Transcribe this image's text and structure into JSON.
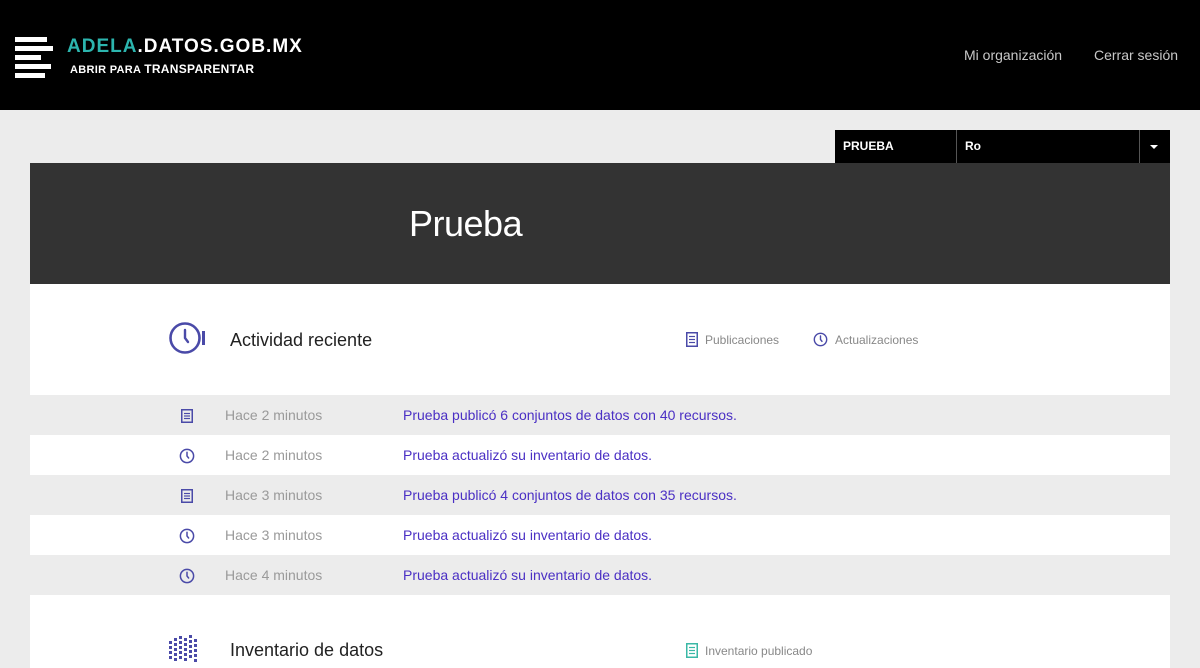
{
  "header": {
    "logo_accent": "ADELA",
    "logo_rest": ".DATOS.GOB.MX",
    "tagline_a": "ABRIR PARA",
    "tagline_b": "TRANSPARENTAR",
    "nav": [
      {
        "label": "Mi organización"
      },
      {
        "label": "Cerrar sesión"
      }
    ]
  },
  "org_selector": {
    "label": "PRUEBA",
    "value": "Ro"
  },
  "hero": {
    "title": "Prueba"
  },
  "activity": {
    "title": "Actividad reciente",
    "filters": [
      {
        "label": "Publicaciones",
        "icon": "document-icon"
      },
      {
        "label": "Actualizaciones",
        "icon": "clock-icon"
      }
    ],
    "rows": [
      {
        "icon": "document-icon",
        "time": "Hace 2 minutos",
        "message": "Prueba publicó 6 conjuntos de datos con 40 recursos."
      },
      {
        "icon": "clock-icon",
        "time": "Hace 2 minutos",
        "message": "Prueba actualizó su inventario de datos."
      },
      {
        "icon": "document-icon",
        "time": "Hace 3 minutos",
        "message": "Prueba publicó 4 conjuntos de datos con 35 recursos."
      },
      {
        "icon": "clock-icon",
        "time": "Hace 3 minutos",
        "message": "Prueba actualizó su inventario de datos."
      },
      {
        "icon": "clock-icon",
        "time": "Hace 4 minutos",
        "message": "Prueba actualizó su inventario de datos."
      }
    ]
  },
  "inventory": {
    "title": "Inventario de datos",
    "filter_label": "Inventario publicado",
    "filter_icon": "document-icon"
  },
  "colors": {
    "accent": "#2cb5ae",
    "icon_purple": "#4a4aa8",
    "link": "#4a2fc4",
    "teal_icon": "#3ab8a6"
  }
}
